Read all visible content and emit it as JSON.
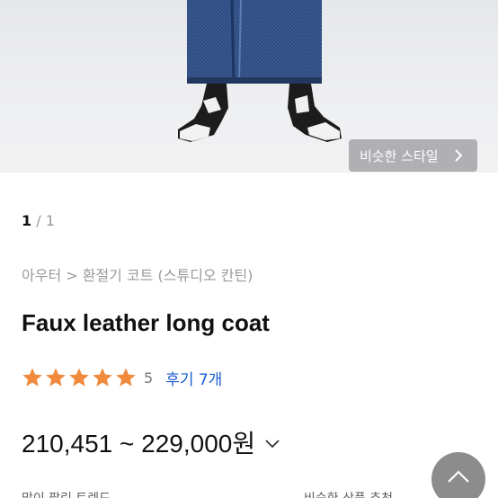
{
  "hero": {
    "similar_style_label": "비슷한 스타일",
    "icons": {
      "similar_chevron": "chevron-right-icon"
    }
  },
  "pager": {
    "current": "1",
    "separator": "/",
    "total": "1"
  },
  "breadcrumb": "아우터 > 환절기 코트 (스튜디오 칸틴)",
  "product": {
    "title": "Faux leather long coat",
    "rating": {
      "stars": 5,
      "score": "5",
      "reviews_label": "후기 7개"
    },
    "price": "210,451 ~ 229,000원"
  },
  "footer_partial": {
    "left": "많이 팔린 트렌드",
    "right": "비슷한 상품 추천"
  },
  "colors": {
    "star": "#f08a3c",
    "link": "#1b5ecf",
    "top_button": "#8c8c8c"
  },
  "icons": {
    "star": "star-icon",
    "price_dropdown": "chevron-down-icon",
    "scroll_top": "chevron-up-icon"
  }
}
